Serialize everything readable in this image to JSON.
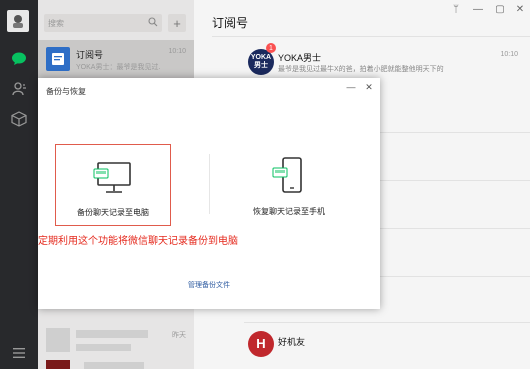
{
  "search": {
    "placeholder": "搜索"
  },
  "chat_list": {
    "items": [
      {
        "name": "订阅号",
        "preview": "YOKA男士：最爷是我见过...",
        "time": "10:10",
        "active": true
      },
      {
        "name": "",
        "preview": "",
        "time": "昨天",
        "active": false
      }
    ]
  },
  "main": {
    "title": "订阅号",
    "window_buttons": [
      "ᛘ",
      "—",
      "▢",
      "✕"
    ],
    "subscriptions": [
      {
        "name": "YOKA男士",
        "logo_text": "YOKA\n男士",
        "desc": "最爷是我见过最牛X的爸，拍着小肥就能整他明天下的",
        "time": "10:10",
        "badge": "1"
      },
      {
        "name": "好机友",
        "logo_text": "H",
        "desc": "",
        "time": "",
        "badge": ""
      }
    ]
  },
  "dialog": {
    "title": "备份与恢复",
    "min_glyph": "—",
    "close_glyph": "✕",
    "option_backup_label": "备份聊天记录至电脑",
    "option_restore_label": "恢复聊天记录至手机",
    "note": "定期利用这个功能将微信聊天记录备份到电脑",
    "manage_link": "管理备份文件"
  },
  "colors": {
    "nav_bg": "#28292c",
    "list_bg": "#e6e5e5",
    "accent_green": "#07c160",
    "note_red": "#e52a1e",
    "link_blue": "#2c5aa0"
  }
}
